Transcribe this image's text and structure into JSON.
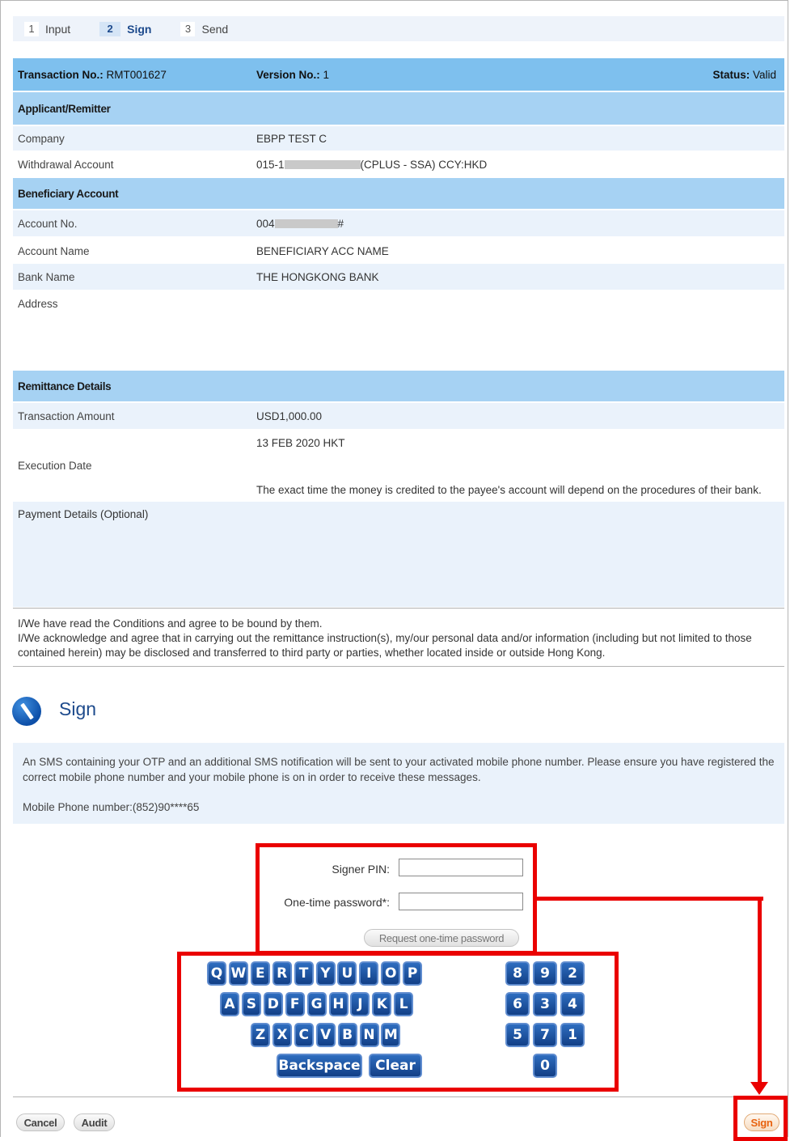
{
  "steps": [
    {
      "num": "1",
      "label": "Input"
    },
    {
      "num": "2",
      "label": "Sign"
    },
    {
      "num": "3",
      "label": "Send"
    }
  ],
  "transaction": {
    "no_label": "Transaction No.:",
    "no_value": "RMT001627",
    "version_label": "Version No.:",
    "version_value": "1",
    "status_label": "Status:",
    "status_value": "Valid"
  },
  "applicant": {
    "heading": "Applicant/Remitter",
    "company_label": "Company",
    "company_value": "EBPP TEST C",
    "withdrawal_label": "Withdrawal Account",
    "withdrawal_prefix": "015-1",
    "withdrawal_suffix": "(CPLUS - SSA)   CCY:HKD"
  },
  "beneficiary": {
    "heading": "Beneficiary Account",
    "account_no_label": "Account No.",
    "account_no_prefix": "004",
    "account_no_suffix": "#",
    "account_name_label": "Account Name",
    "account_name_value": "BENEFICIARY ACC NAME",
    "bank_name_label": "Bank Name",
    "bank_name_value": "THE HONGKONG BANK",
    "address_label": "Address"
  },
  "remittance": {
    "heading": "Remittance Details",
    "amount_label": "Transaction Amount",
    "amount_value": "USD1,000.00",
    "exec_label": "Execution Date",
    "exec_date": "13 FEB 2020 HKT",
    "exec_note": "The exact time the money is credited to the payee's account will depend on the procedures of their bank.",
    "payment_details_label": "Payment Details (Optional)"
  },
  "terms": {
    "line1": "I/We have read the Conditions and agree to be bound by them.",
    "line2": "I/We acknowledge and agree that in carrying out the remittance instruction(s), my/our personal data and/or information (including but not limited to those contained herein) may be disclosed and transferred to third party or parties, whether located inside or outside Hong Kong."
  },
  "sign": {
    "title": "Sign",
    "sms_notice": "An SMS containing your OTP and an additional SMS notification will be sent to your activated mobile phone number. Please ensure you have registered the correct mobile phone number and your mobile phone is on in order to receive these messages.",
    "mobile": "Mobile Phone number:(852)90****65",
    "signer_pin_label": "Signer PIN:",
    "otp_label": "One-time password*:",
    "request_otp": "Request one-time password"
  },
  "keyboard": {
    "row1": [
      "Q",
      "W",
      "E",
      "R",
      "T",
      "Y",
      "U",
      "I",
      "O",
      "P"
    ],
    "row2": [
      "A",
      "S",
      "D",
      "F",
      "G",
      "H",
      "J",
      "K",
      "L"
    ],
    "row3": [
      "Z",
      "X",
      "C",
      "V",
      "B",
      "N",
      "M"
    ],
    "backspace": "Backspace",
    "clear": "Clear",
    "digits_row1": [
      "8",
      "9",
      "2"
    ],
    "digits_row2": [
      "6",
      "3",
      "4"
    ],
    "digits_row3": [
      "5",
      "7",
      "1"
    ],
    "digit_zero": "0"
  },
  "footer": {
    "cancel": "Cancel",
    "audit": "Audit",
    "sign": "Sign"
  },
  "colors": {
    "accent": "#1d4a8c",
    "header_row": "#7ec0ee",
    "section_row": "#a6d2f3",
    "alt_row": "#eaf2fb",
    "annotation": "#ea0000",
    "sign_button": "#e8620f"
  }
}
